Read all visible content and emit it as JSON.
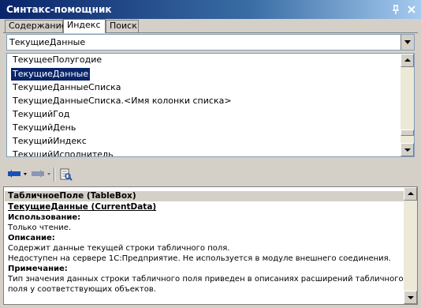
{
  "window": {
    "title": "Синтакс-помощник"
  },
  "titlebar": {
    "pin_glyph": "ₓ",
    "close_glyph": "✕"
  },
  "tabs": [
    {
      "label": "Содержание",
      "active": false
    },
    {
      "label": "Индекс",
      "active": true
    },
    {
      "label": "Поиск",
      "active": false
    }
  ],
  "index": {
    "search_value": "ТекущиеДанные",
    "items": [
      {
        "label": "ТекущееПолугодие",
        "selected": false
      },
      {
        "label": "ТекущиеДанные",
        "selected": true
      },
      {
        "label": "ТекущиеДанныеСписка",
        "selected": false
      },
      {
        "label": "ТекущиеДанныеСписка.<Имя колонки списка>",
        "selected": false
      },
      {
        "label": "ТекущийГод",
        "selected": false
      },
      {
        "label": "ТекущийДень",
        "selected": false
      },
      {
        "label": "ТекущийИндекс",
        "selected": false
      },
      {
        "label": "ТекущийИсполнитель",
        "selected": false
      }
    ]
  },
  "toolbar": {
    "icons": [
      "back-arrow-icon",
      "forward-arrow-icon",
      "find-in-tree-icon"
    ],
    "colors": {
      "back_arrow": "#1a4fb8",
      "forward_arrow": "#8a96b4"
    }
  },
  "doc": {
    "header": "ТабличноеПоле (TableBox)",
    "link": "ТекущиеДанные (CurrentData)",
    "usage_label": "Использование:",
    "usage_text": "Только чтение.",
    "desc_label": "Описание:",
    "desc_line1": "Содержит данные текущей строки табличного поля.",
    "desc_line2": "Недоступен на сервере 1С:Предприятие. Не используется в модуле внешнего соединения.",
    "note_label": "Примечание:",
    "note_line1": "Тип значения данных строки табличного поля приведен в описаниях расширений табличного",
    "note_line2": "поля у соответствующих объектов."
  },
  "colors": {
    "titlebar_start": "#0a246a",
    "titlebar_end": "#a6caf0",
    "selection": "#0a246a",
    "chrome": "#d4d0c8"
  }
}
